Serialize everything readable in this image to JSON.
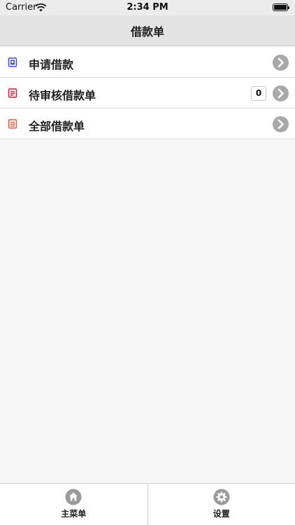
{
  "status_bar": {
    "carrier": "Carrier",
    "time": "2:34 PM",
    "icons": [
      "wifi-icon",
      "battery-icon"
    ]
  },
  "nav": {
    "title": "借款单"
  },
  "menu": {
    "items": [
      {
        "label": "申请借款",
        "icon": "apply-form-icon",
        "icon_color": "#3b4fd6"
      },
      {
        "label": "待审核借款单",
        "icon": "pending-form-icon",
        "icon_color": "#c0283a",
        "count": "0"
      },
      {
        "label": "全部借款单",
        "icon": "all-forms-icon",
        "icon_color": "#e0604a"
      }
    ]
  },
  "tab_bar": {
    "tabs": [
      {
        "label": "主菜单",
        "icon": "home-icon"
      },
      {
        "label": "设置",
        "icon": "gear-icon"
      }
    ]
  },
  "colors": {
    "chevron": "#a8a8a8",
    "nav_bg": "#e3e3e3",
    "tab_icon": "#9a9a9a"
  }
}
